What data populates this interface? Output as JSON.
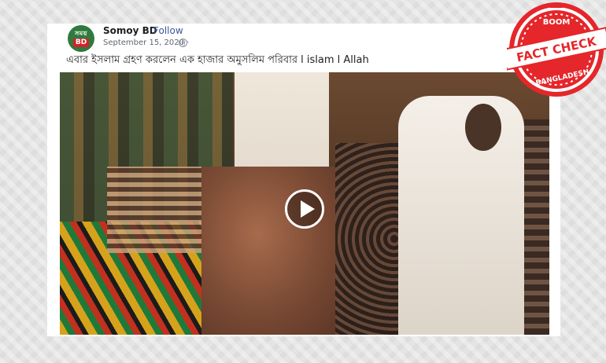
{
  "post": {
    "page_name": "Somoy BD",
    "separator": "·",
    "follow_label": "Follow",
    "date": "September 15, 2020 ·",
    "caption": "এবার ইসলাম গ্রহণ করলেন এক হাজার অমুসলিম পরিবার l islam l Allah"
  },
  "avatar": {
    "top_text": "সময়",
    "bottom_text": "BD"
  },
  "badge": {
    "brand": "BOOM",
    "label": "FACT CHECK",
    "region": "BANGLADESH",
    "color": "#e5262a"
  },
  "icons": {
    "privacy": "globe-icon",
    "video": "play-icon"
  }
}
